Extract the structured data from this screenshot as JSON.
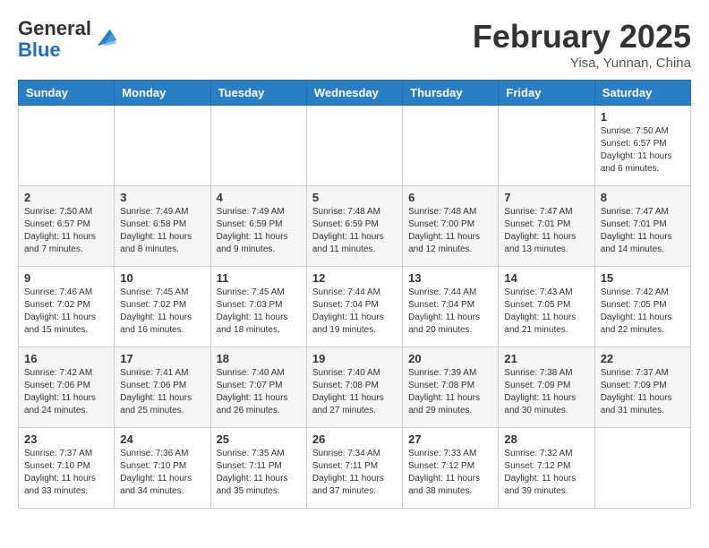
{
  "header": {
    "logo_line1": "General",
    "logo_line2": "Blue",
    "month": "February 2025",
    "location": "Yisa, Yunnan, China"
  },
  "weekdays": [
    "Sunday",
    "Monday",
    "Tuesday",
    "Wednesday",
    "Thursday",
    "Friday",
    "Saturday"
  ],
  "weeks": [
    [
      {
        "day": "",
        "info": ""
      },
      {
        "day": "",
        "info": ""
      },
      {
        "day": "",
        "info": ""
      },
      {
        "day": "",
        "info": ""
      },
      {
        "day": "",
        "info": ""
      },
      {
        "day": "",
        "info": ""
      },
      {
        "day": "1",
        "info": "Sunrise: 7:50 AM\nSunset: 6:57 PM\nDaylight: 11 hours and 6 minutes."
      }
    ],
    [
      {
        "day": "2",
        "info": "Sunrise: 7:50 AM\nSunset: 6:57 PM\nDaylight: 11 hours and 7 minutes."
      },
      {
        "day": "3",
        "info": "Sunrise: 7:49 AM\nSunset: 6:58 PM\nDaylight: 11 hours and 8 minutes."
      },
      {
        "day": "4",
        "info": "Sunrise: 7:49 AM\nSunset: 6:59 PM\nDaylight: 11 hours and 9 minutes."
      },
      {
        "day": "5",
        "info": "Sunrise: 7:48 AM\nSunset: 6:59 PM\nDaylight: 11 hours and 11 minutes."
      },
      {
        "day": "6",
        "info": "Sunrise: 7:48 AM\nSunset: 7:00 PM\nDaylight: 11 hours and 12 minutes."
      },
      {
        "day": "7",
        "info": "Sunrise: 7:47 AM\nSunset: 7:01 PM\nDaylight: 11 hours and 13 minutes."
      },
      {
        "day": "8",
        "info": "Sunrise: 7:47 AM\nSunset: 7:01 PM\nDaylight: 11 hours and 14 minutes."
      }
    ],
    [
      {
        "day": "9",
        "info": "Sunrise: 7:46 AM\nSunset: 7:02 PM\nDaylight: 11 hours and 15 minutes."
      },
      {
        "day": "10",
        "info": "Sunrise: 7:45 AM\nSunset: 7:02 PM\nDaylight: 11 hours and 16 minutes."
      },
      {
        "day": "11",
        "info": "Sunrise: 7:45 AM\nSunset: 7:03 PM\nDaylight: 11 hours and 18 minutes."
      },
      {
        "day": "12",
        "info": "Sunrise: 7:44 AM\nSunset: 7:04 PM\nDaylight: 11 hours and 19 minutes."
      },
      {
        "day": "13",
        "info": "Sunrise: 7:44 AM\nSunset: 7:04 PM\nDaylight: 11 hours and 20 minutes."
      },
      {
        "day": "14",
        "info": "Sunrise: 7:43 AM\nSunset: 7:05 PM\nDaylight: 11 hours and 21 minutes."
      },
      {
        "day": "15",
        "info": "Sunrise: 7:42 AM\nSunset: 7:05 PM\nDaylight: 11 hours and 22 minutes."
      }
    ],
    [
      {
        "day": "16",
        "info": "Sunrise: 7:42 AM\nSunset: 7:06 PM\nDaylight: 11 hours and 24 minutes."
      },
      {
        "day": "17",
        "info": "Sunrise: 7:41 AM\nSunset: 7:06 PM\nDaylight: 11 hours and 25 minutes."
      },
      {
        "day": "18",
        "info": "Sunrise: 7:40 AM\nSunset: 7:07 PM\nDaylight: 11 hours and 26 minutes."
      },
      {
        "day": "19",
        "info": "Sunrise: 7:40 AM\nSunset: 7:08 PM\nDaylight: 11 hours and 27 minutes."
      },
      {
        "day": "20",
        "info": "Sunrise: 7:39 AM\nSunset: 7:08 PM\nDaylight: 11 hours and 29 minutes."
      },
      {
        "day": "21",
        "info": "Sunrise: 7:38 AM\nSunset: 7:09 PM\nDaylight: 11 hours and 30 minutes."
      },
      {
        "day": "22",
        "info": "Sunrise: 7:37 AM\nSunset: 7:09 PM\nDaylight: 11 hours and 31 minutes."
      }
    ],
    [
      {
        "day": "23",
        "info": "Sunrise: 7:37 AM\nSunset: 7:10 PM\nDaylight: 11 hours and 33 minutes."
      },
      {
        "day": "24",
        "info": "Sunrise: 7:36 AM\nSunset: 7:10 PM\nDaylight: 11 hours and 34 minutes."
      },
      {
        "day": "25",
        "info": "Sunrise: 7:35 AM\nSunset: 7:11 PM\nDaylight: 11 hours and 35 minutes."
      },
      {
        "day": "26",
        "info": "Sunrise: 7:34 AM\nSunset: 7:11 PM\nDaylight: 11 hours and 37 minutes."
      },
      {
        "day": "27",
        "info": "Sunrise: 7:33 AM\nSunset: 7:12 PM\nDaylight: 11 hours and 38 minutes."
      },
      {
        "day": "28",
        "info": "Sunrise: 7:32 AM\nSunset: 7:12 PM\nDaylight: 11 hours and 39 minutes."
      },
      {
        "day": "",
        "info": ""
      }
    ]
  ]
}
